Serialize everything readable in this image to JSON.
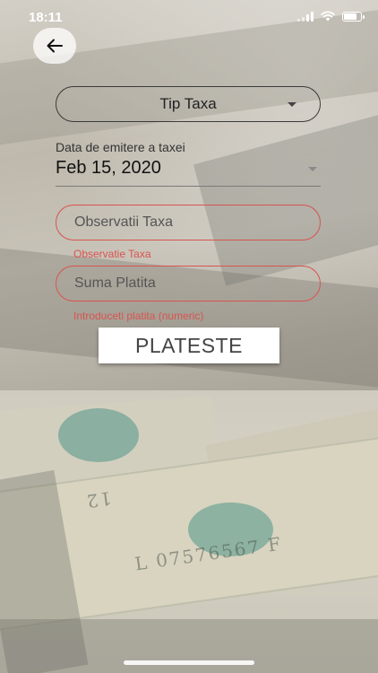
{
  "status_bar": {
    "time": "18:11"
  },
  "back_button": {
    "icon": "arrow-left-icon"
  },
  "tax_type_dropdown": {
    "label": "Tip Taxa"
  },
  "issue_date": {
    "label": "Data de emitere a taxei",
    "value": "Feb 15, 2020"
  },
  "observation_field": {
    "placeholder": "Observatii Taxa",
    "error": "Observatie Taxa"
  },
  "amount_field": {
    "placeholder": "Suma Platita",
    "error": "Introduceti platita (numeric)"
  },
  "pay_button": {
    "label": "PLATESTE"
  },
  "banknote_text": {
    "serial": "L 07576567 F",
    "denomination": "12"
  },
  "colors": {
    "error": "#d9534f",
    "outline": "#3a3a3a",
    "button_bg": "#ffffff"
  }
}
